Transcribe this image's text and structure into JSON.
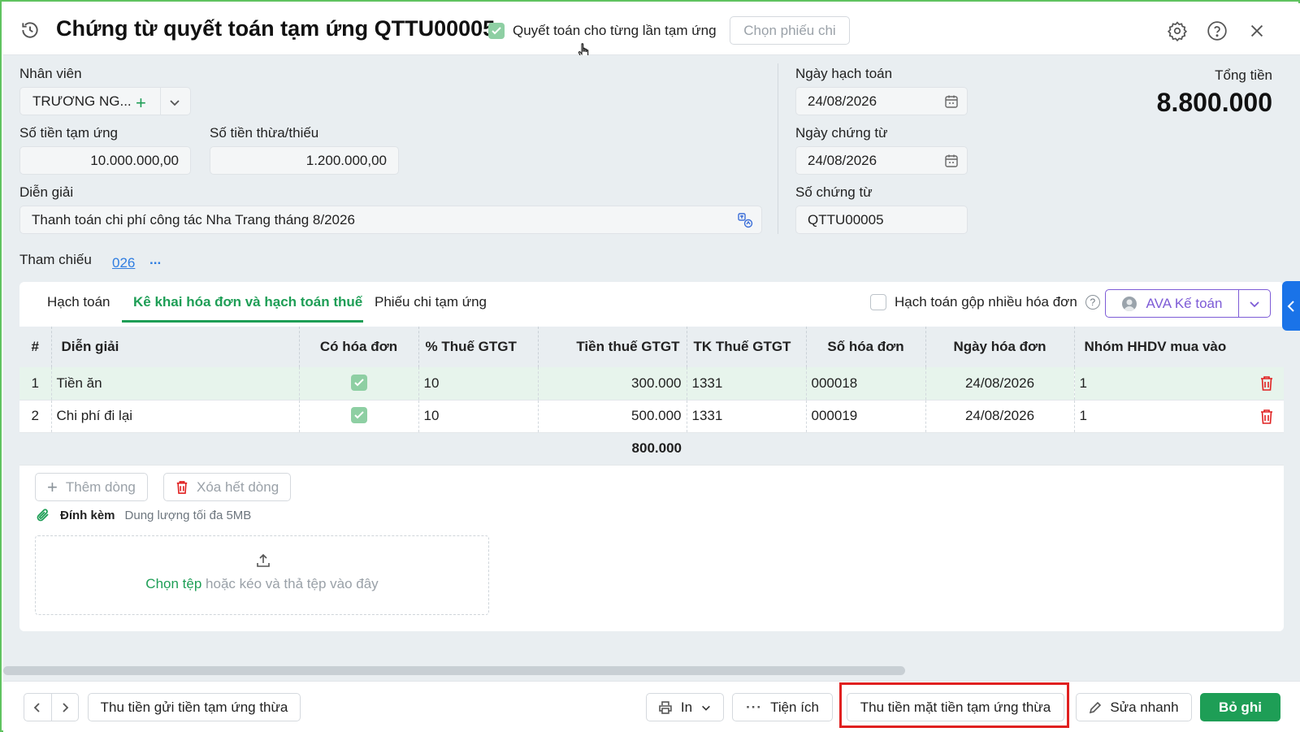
{
  "header": {
    "title": "Chứng từ quyết toán tạm ứng QTTU00005",
    "settle_checkbox_label": "Quyết toán cho từng lần tạm ứng",
    "select_payment_label": "Chọn phiếu chi"
  },
  "form": {
    "employee_label": "Nhân viên",
    "employee_value": "TRƯƠNG NG...",
    "advance_amount_label": "Số tiền tạm ứng",
    "advance_amount_value": "10.000.000,00",
    "surplus_label": "Số tiền thừa/thiếu",
    "surplus_value": "1.200.000,00",
    "description_label": "Diễn giải",
    "description_value": "Thanh toán chi phí công tác Nha Trang tháng 8/2026",
    "posting_date_label": "Ngày hạch toán",
    "posting_date_value": "24/08/2026",
    "doc_date_label": "Ngày chứng từ",
    "doc_date_value": "24/08/2026",
    "doc_no_label": "Số chứng từ",
    "doc_no_value": "QTTU00005",
    "total_label": "Tổng tiền",
    "total_value": "8.800.000",
    "reference_label": "Tham chiếu",
    "reference_link": "026",
    "reference_more": "..."
  },
  "tabs": [
    {
      "label": "Hạch toán"
    },
    {
      "label": "Kê khai hóa đơn và hạch toán thuế"
    },
    {
      "label": "Phiếu chi tạm ứng"
    }
  ],
  "combine_invoices_label": "Hạch toán gộp nhiều hóa đơn",
  "ava_button_label": "AVA Kế toán",
  "table": {
    "headers": [
      "#",
      "Diễn giải",
      "Có hóa đơn",
      "% Thuế GTGT",
      "Tiền thuế GTGT",
      "TK Thuế GTGT",
      "Số hóa đơn",
      "Ngày hóa đơn",
      "Nhóm HHDV mua vào"
    ],
    "rows": [
      {
        "idx": "1",
        "desc": "Tiền ăn",
        "rate": "10",
        "tax": "300.000",
        "acct": "1331",
        "invoice_no": "000018",
        "invoice_date": "24/08/2026",
        "group": "1"
      },
      {
        "idx": "2",
        "desc": "Chi phí đi lại",
        "rate": "10",
        "tax": "500.000",
        "acct": "1331",
        "invoice_no": "000019",
        "invoice_date": "24/08/2026",
        "group": "1"
      }
    ],
    "total_tax": "800.000"
  },
  "add_row_label": "Thêm dòng",
  "clear_rows_label": "Xóa hết dòng",
  "attachment": {
    "label": "Đính kèm",
    "limit": "Dung lượng tối đa 5MB",
    "choose_file": "Chọn tệp",
    "drop_hint": "hoặc kéo và thả tệp vào đây"
  },
  "footer": {
    "deposit_refund_label": "Thu tiền gửi tiền tạm ứng thừa",
    "print_label": "In",
    "utilities_label": "Tiện ích",
    "cash_refund_label": "Thu tiền mặt tiền tạm ứng thừa",
    "quick_edit_label": "Sửa nhanh",
    "unpost_label": "Bỏ ghi"
  },
  "colors": {
    "accent_green": "#1e9e56",
    "highlight_red": "#e02020",
    "ava_purple": "#7d5bd6"
  }
}
